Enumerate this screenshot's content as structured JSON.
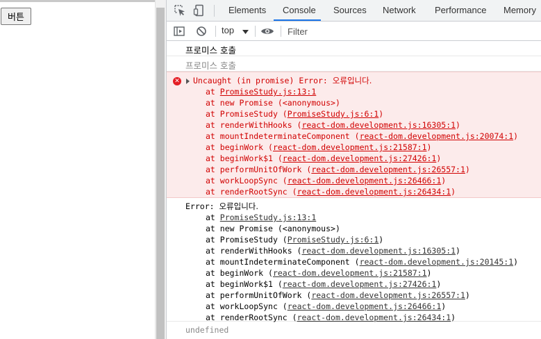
{
  "page": {
    "button_label": "버튼"
  },
  "devtools": {
    "tabs": [
      "Elements",
      "Console",
      "Sources",
      "Network",
      "Performance",
      "Memory"
    ],
    "active_tab": "Console",
    "context": "top",
    "filter_placeholder": "Filter"
  },
  "console": {
    "log1": "프로미스 호출",
    "log2": "프로미스 호출",
    "error": {
      "headline_prefix": "Uncaught (in promise) Error: ",
      "headline_msg": "오류입니다.",
      "stack": [
        {
          "prefix": "at ",
          "fn": "",
          "link": "PromiseStudy.js:13:1",
          "suffix": ""
        },
        {
          "prefix": "at ",
          "fn": "new Promise (<anonymous>)",
          "link": "",
          "suffix": ""
        },
        {
          "prefix": "at ",
          "fn": "PromiseStudy (",
          "link": "PromiseStudy.js:6:1",
          "suffix": ")"
        },
        {
          "prefix": "at ",
          "fn": "renderWithHooks (",
          "link": "react-dom.development.js:16305:1",
          "suffix": ")"
        },
        {
          "prefix": "at ",
          "fn": "mountIndeterminateComponent (",
          "link": "react-dom.development.js:20074:1",
          "suffix": ")"
        },
        {
          "prefix": "at ",
          "fn": "beginWork (",
          "link": "react-dom.development.js:21587:1",
          "suffix": ")"
        },
        {
          "prefix": "at ",
          "fn": "beginWork$1 (",
          "link": "react-dom.development.js:27426:1",
          "suffix": ")"
        },
        {
          "prefix": "at ",
          "fn": "performUnitOfWork (",
          "link": "react-dom.development.js:26557:1",
          "suffix": ")"
        },
        {
          "prefix": "at ",
          "fn": "workLoopSync (",
          "link": "react-dom.development.js:26466:1",
          "suffix": ")"
        },
        {
          "prefix": "at ",
          "fn": "renderRootSync (",
          "link": "react-dom.development.js:26434:1",
          "suffix": ")"
        }
      ]
    },
    "log_error": {
      "headline_prefix": "Error: ",
      "headline_msg": "오류입니다.",
      "stack": [
        {
          "prefix": "at ",
          "fn": "",
          "link": "PromiseStudy.js:13:1",
          "suffix": ""
        },
        {
          "prefix": "at ",
          "fn": "new Promise (<anonymous>)",
          "link": "",
          "suffix": ""
        },
        {
          "prefix": "at ",
          "fn": "PromiseStudy (",
          "link": "PromiseStudy.js:6:1",
          "suffix": ")"
        },
        {
          "prefix": "at ",
          "fn": "renderWithHooks (",
          "link": "react-dom.development.js:16305:1",
          "suffix": ")"
        },
        {
          "prefix": "at ",
          "fn": "mountIndeterminateComponent (",
          "link": "react-dom.development.js:20145:1",
          "suffix": ")"
        },
        {
          "prefix": "at ",
          "fn": "beginWork (",
          "link": "react-dom.development.js:21587:1",
          "suffix": ")"
        },
        {
          "prefix": "at ",
          "fn": "beginWork$1 (",
          "link": "react-dom.development.js:27426:1",
          "suffix": ")"
        },
        {
          "prefix": "at ",
          "fn": "performUnitOfWork (",
          "link": "react-dom.development.js:26557:1",
          "suffix": ")"
        },
        {
          "prefix": "at ",
          "fn": "workLoopSync (",
          "link": "react-dom.development.js:26466:1",
          "suffix": ")"
        },
        {
          "prefix": "at ",
          "fn": "renderRootSync (",
          "link": "react-dom.development.js:26434:1",
          "suffix": ")"
        }
      ]
    },
    "result": "undefined"
  },
  "colors": {
    "error_text": "#d10000",
    "error_bg": "#fcebeb",
    "accent": "#1a73e8"
  },
  "icons": [
    "inspect-icon",
    "device-toggle-icon",
    "sidebar-toggle-icon",
    "clear-console-icon",
    "dropdown-caret-icon",
    "eye-icon",
    "error-icon",
    "expand-caret-icon"
  ]
}
